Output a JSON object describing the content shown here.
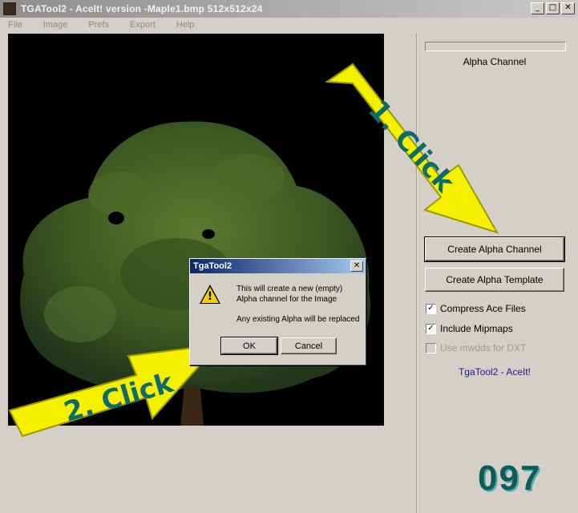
{
  "window": {
    "title": "TGATool2 - AceIt! version -Maple1.bmp  512x512x24",
    "controls": {
      "minimize": "_",
      "maximize": "□",
      "close": "✕"
    }
  },
  "menu": [
    "File",
    "Image",
    "Prefs",
    "Export",
    "Help"
  ],
  "sidebar": {
    "alpha_label": "Alpha Channel",
    "create_alpha_channel": "Create Alpha Channel",
    "create_alpha_template": "Create Alpha Template",
    "options": [
      {
        "label": "Compress Ace Files",
        "checked": true,
        "enabled": true
      },
      {
        "label": "Include Mipmaps",
        "checked": true,
        "enabled": true
      },
      {
        "label": "Use mwdds for DXT",
        "checked": false,
        "enabled": false
      }
    ],
    "brand": "TgaTool2 - AceIt!"
  },
  "dialog": {
    "title": "TgaTool2",
    "close": "✕",
    "line1": "This will create a new (empty)",
    "line2": "Alpha channel for the Image",
    "line3": "Any existing Alpha will be replaced",
    "ok": "OK",
    "cancel": "Cancel"
  },
  "annotations": {
    "step1": "1. Click",
    "step2": "2. Click",
    "page_number": "097"
  },
  "colors": {
    "arrow": "#f5f000",
    "arrow_text": "#0f6b6b",
    "titlebar_active": "#0a246a"
  }
}
